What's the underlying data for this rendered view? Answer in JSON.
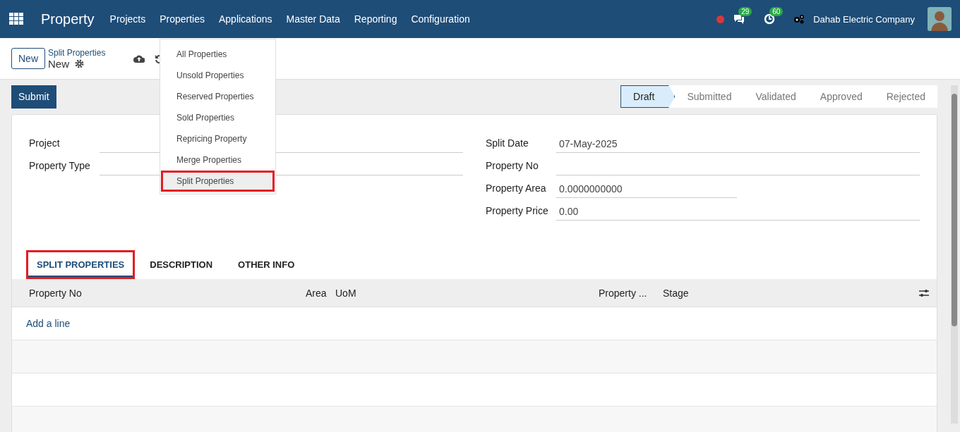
{
  "navbar": {
    "app_name": "Property",
    "menu": [
      "Projects",
      "Properties",
      "Applications",
      "Master Data",
      "Reporting",
      "Configuration"
    ],
    "messages_badge": "29",
    "activities_badge": "60",
    "company": "Dahab Electric Company"
  },
  "control_panel": {
    "new_button": "New",
    "breadcrumb": "Split Properties",
    "record_name": "New"
  },
  "dropdown": [
    {
      "label": "All Properties",
      "highlighted": false
    },
    {
      "label": "Unsold Properties",
      "highlighted": false
    },
    {
      "label": "Reserved Properties",
      "highlighted": false
    },
    {
      "label": "Sold Properties",
      "highlighted": false
    },
    {
      "label": "Repricing Property",
      "highlighted": false
    },
    {
      "label": "Merge Properties",
      "highlighted": false
    },
    {
      "label": "Split Properties",
      "highlighted": true
    }
  ],
  "submit_button": "Submit",
  "stages": [
    {
      "label": "Draft",
      "selected": true
    },
    {
      "label": "Submitted",
      "selected": false
    },
    {
      "label": "Validated",
      "selected": false
    },
    {
      "label": "Approved",
      "selected": false
    },
    {
      "label": "Rejected",
      "selected": false
    }
  ],
  "left_fields": [
    {
      "label": "Project"
    },
    {
      "label": "Property Type"
    }
  ],
  "right_fields": [
    {
      "label": "Split Date",
      "value": "07-May-2025",
      "kind": "wide"
    },
    {
      "label": "Property No",
      "kind": "wide"
    },
    {
      "label": "Property Area",
      "value": "0.0000000000",
      "kind": "narrow"
    },
    {
      "label": "Property Price",
      "value": "0.00",
      "kind": "wide"
    }
  ],
  "tabs": [
    {
      "label": "SPLIT PROPERTIES",
      "selected": true,
      "highlighted": true
    },
    {
      "label": "DESCRIPTION",
      "selected": false,
      "highlighted": false
    },
    {
      "label": "OTHER INFO",
      "selected": false,
      "highlighted": false
    }
  ],
  "table": {
    "columns": [
      "Property No",
      "Area",
      "UoM",
      "Property ...",
      "Stage"
    ],
    "add_line": "Add a line"
  }
}
